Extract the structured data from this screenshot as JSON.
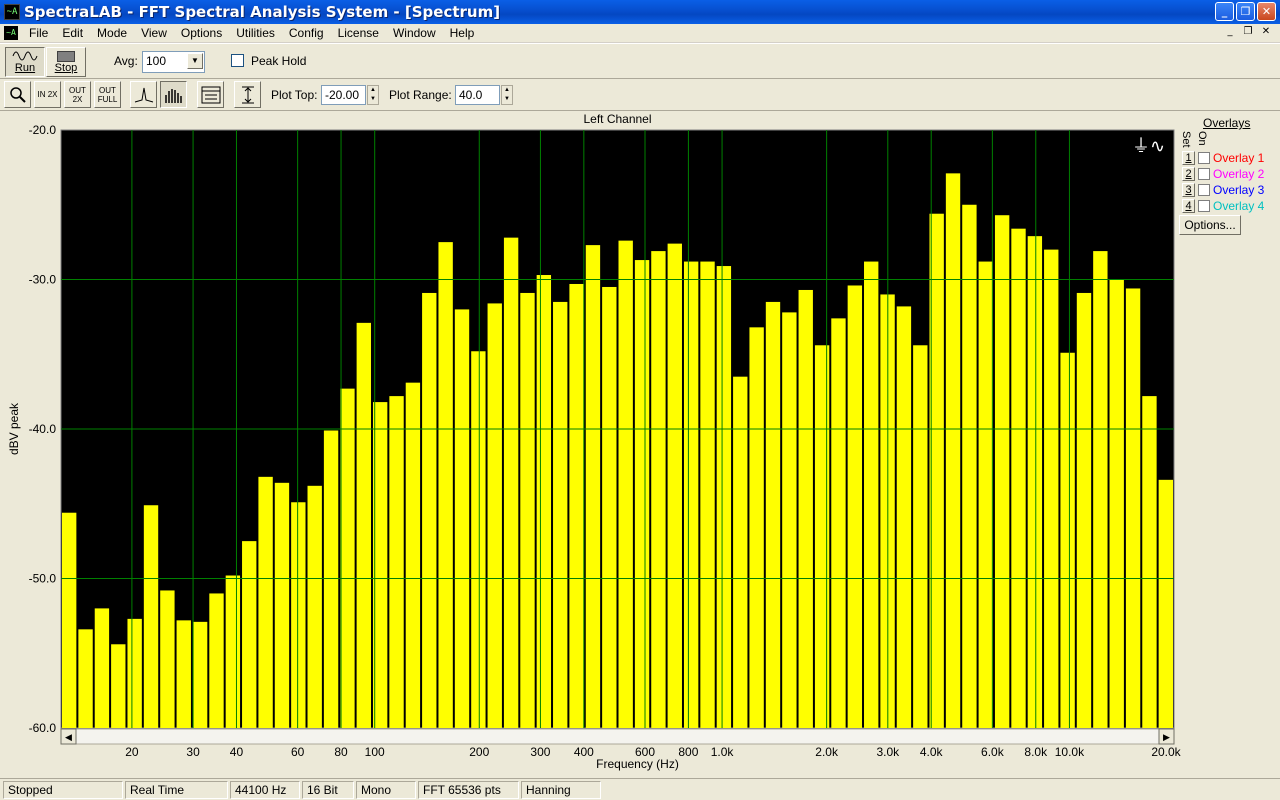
{
  "window": {
    "title": "SpectraLAB - FFT Spectral Analysis System - [Spectrum]",
    "app_icon": "~A"
  },
  "menu": {
    "items": [
      "File",
      "Edit",
      "Mode",
      "View",
      "Options",
      "Utilities",
      "Config",
      "License",
      "Window",
      "Help"
    ]
  },
  "toolbar": {
    "run_label": "Run",
    "stop_label": "Stop",
    "avg_label": "Avg:",
    "avg_value": "100",
    "peak_hold_label": "Peak Hold",
    "plot_top_label": "Plot Top:",
    "plot_top_value": "-20.00",
    "plot_range_label": "Plot Range:",
    "plot_range_value": "40.0",
    "zoom_in_label": "IN 2X",
    "zoom_out_label": "OUT 2X",
    "zoom_full_label": "OUT FULL"
  },
  "overlays": {
    "title": "Overlays",
    "set_label": "Set",
    "on_label": "On",
    "items": [
      {
        "set": "1",
        "label": "Overlay 1",
        "color": "#ff0000"
      },
      {
        "set": "2",
        "label": "Overlay 2",
        "color": "#ff00ff"
      },
      {
        "set": "3",
        "label": "Overlay 3",
        "color": "#0000ff"
      },
      {
        "set": "4",
        "label": "Overlay 4",
        "color": "#00c0c0"
      }
    ],
    "options_label": "Options..."
  },
  "status": {
    "cells": [
      "Stopped",
      "Real Time",
      "44100 Hz",
      "16 Bit",
      "Mono",
      "FFT 65536 pts",
      "Hanning"
    ]
  },
  "chart_data": {
    "type": "bar",
    "title": "Left Channel",
    "xlabel": "Frequency (Hz)",
    "ylabel": "dBV peak",
    "ylim": [
      -60,
      -20
    ],
    "x_scale": "log",
    "xlim": [
      12.5,
      20000
    ],
    "y_ticks": [
      "-20.0",
      "-30.0",
      "-40.0",
      "-50.0",
      "-60.0"
    ],
    "x_ticks": [
      {
        "v": 20,
        "label": "20"
      },
      {
        "v": 30,
        "label": "30"
      },
      {
        "v": 40,
        "label": "40"
      },
      {
        "v": 60,
        "label": "60"
      },
      {
        "v": 80,
        "label": "80"
      },
      {
        "v": 100,
        "label": "100"
      },
      {
        "v": 200,
        "label": "200"
      },
      {
        "v": 300,
        "label": "300"
      },
      {
        "v": 400,
        "label": "400"
      },
      {
        "v": 600,
        "label": "600"
      },
      {
        "v": 800,
        "label": "800"
      },
      {
        "v": 1000,
        "label": "1.0k"
      },
      {
        "v": 2000,
        "label": "2.0k"
      },
      {
        "v": 3000,
        "label": "3.0k"
      },
      {
        "v": 4000,
        "label": "4.0k"
      },
      {
        "v": 6000,
        "label": "6.0k"
      },
      {
        "v": 8000,
        "label": "8.0k"
      },
      {
        "v": 10000,
        "label": "10.0k"
      },
      {
        "v": 20000,
        "label": "20.0k"
      }
    ],
    "grid": true,
    "bar_color": "#ffff00",
    "background_color": "#000000",
    "grid_color": "#008000",
    "values": [
      -45.6,
      -53.4,
      -52.0,
      -54.4,
      -52.7,
      -45.1,
      -50.8,
      -52.8,
      -52.9,
      -51.0,
      -49.8,
      -47.5,
      -43.2,
      -43.6,
      -44.9,
      -43.8,
      -40.1,
      -37.3,
      -32.9,
      -38.2,
      -37.8,
      -36.9,
      -30.9,
      -27.5,
      -32.0,
      -34.8,
      -31.6,
      -27.2,
      -30.9,
      -29.7,
      -31.5,
      -30.3,
      -27.7,
      -30.5,
      -27.4,
      -28.7,
      -28.1,
      -27.6,
      -28.8,
      -28.8,
      -29.1,
      -36.5,
      -33.2,
      -31.5,
      -32.2,
      -30.7,
      -34.4,
      -32.6,
      -30.4,
      -28.8,
      -31.0,
      -31.8,
      -34.4,
      -25.6,
      -22.9,
      -25.0,
      -28.8,
      -25.7,
      -26.6,
      -27.1,
      -28.0,
      -34.9,
      -30.9,
      -28.1,
      -30.0,
      -30.6,
      -37.8,
      -43.4
    ]
  }
}
